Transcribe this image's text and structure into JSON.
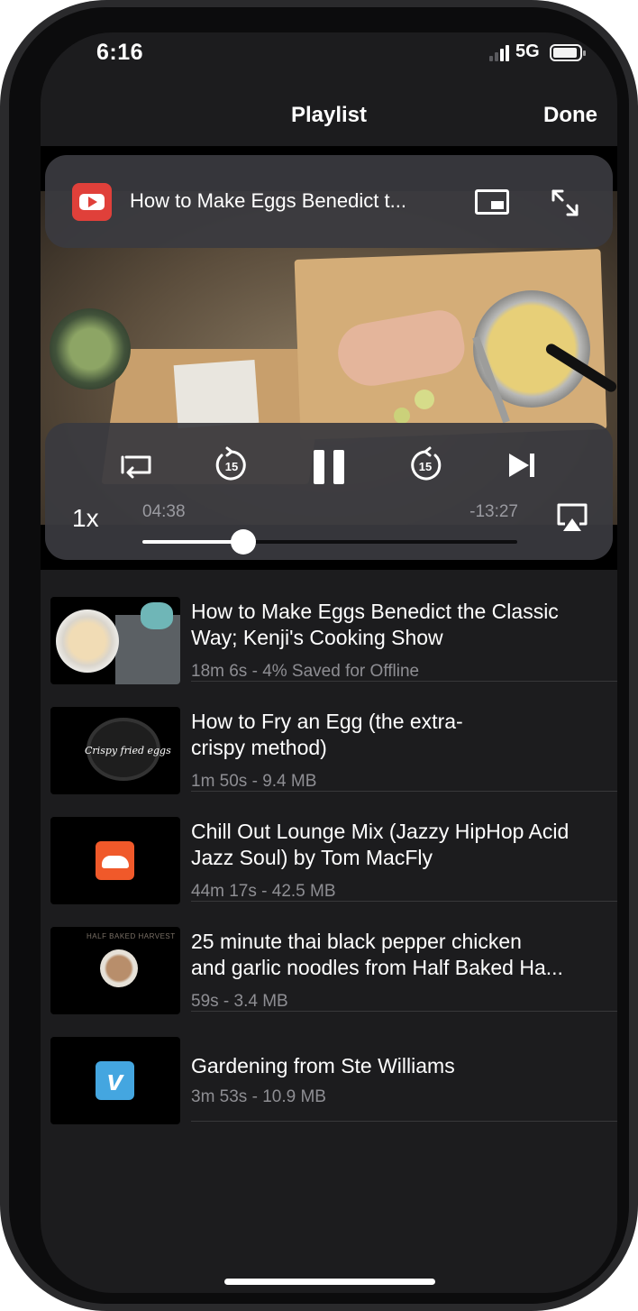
{
  "status_bar": {
    "time": "6:16",
    "network": "5G"
  },
  "nav": {
    "title": "Playlist",
    "done_label": "Done"
  },
  "player": {
    "now_playing_title": "How to Make Eggs Benedict t...",
    "speed_label": "1x",
    "elapsed": "04:38",
    "remaining": "-13:27",
    "progress": 0.27,
    "skip_back_seconds": "15",
    "skip_forward_seconds": "15",
    "source_icon": "youtube-icon"
  },
  "playlist": [
    {
      "title": "How to Make Eggs Benedict the Classic Way; Kenji's Cooking Show",
      "meta": "18m 6s - 4% Saved for Offline",
      "thumb": "eggs"
    },
    {
      "title": "How to Fry an Egg (the extra-crispy method)",
      "title_l1": "How to Fry an Egg (the extra-",
      "title_l2": "crispy method)",
      "meta": "1m 50s - 9.4 MB",
      "thumb": "fry",
      "thumb_caption": "Crispy fried eggs"
    },
    {
      "title": "Chill Out Lounge Mix (Jazzy HipHop Acid Jazz Soul) by Tom MacFly",
      "meta": "44m 17s - 42.5 MB",
      "thumb": "soundcloud"
    },
    {
      "title": "25 minute thai black pepper chicken and garlic noodles from Half Baked Ha...",
      "meta": "59s - 3.4 MB",
      "thumb": "thai",
      "thumb_caption": "HALF BAKED HARVEST"
    },
    {
      "title": "Gardening from Ste Williams",
      "meta": "3m 53s - 10.9 MB",
      "thumb": "vimeo",
      "thumb_letter": "v"
    }
  ],
  "colors": {
    "background": "#1c1c1e",
    "panel": "#3a3a40",
    "secondary_text": "#8e8e93",
    "youtube": "#e0403a",
    "soundcloud": "#f0592a",
    "vimeo": "#44a6e0"
  }
}
